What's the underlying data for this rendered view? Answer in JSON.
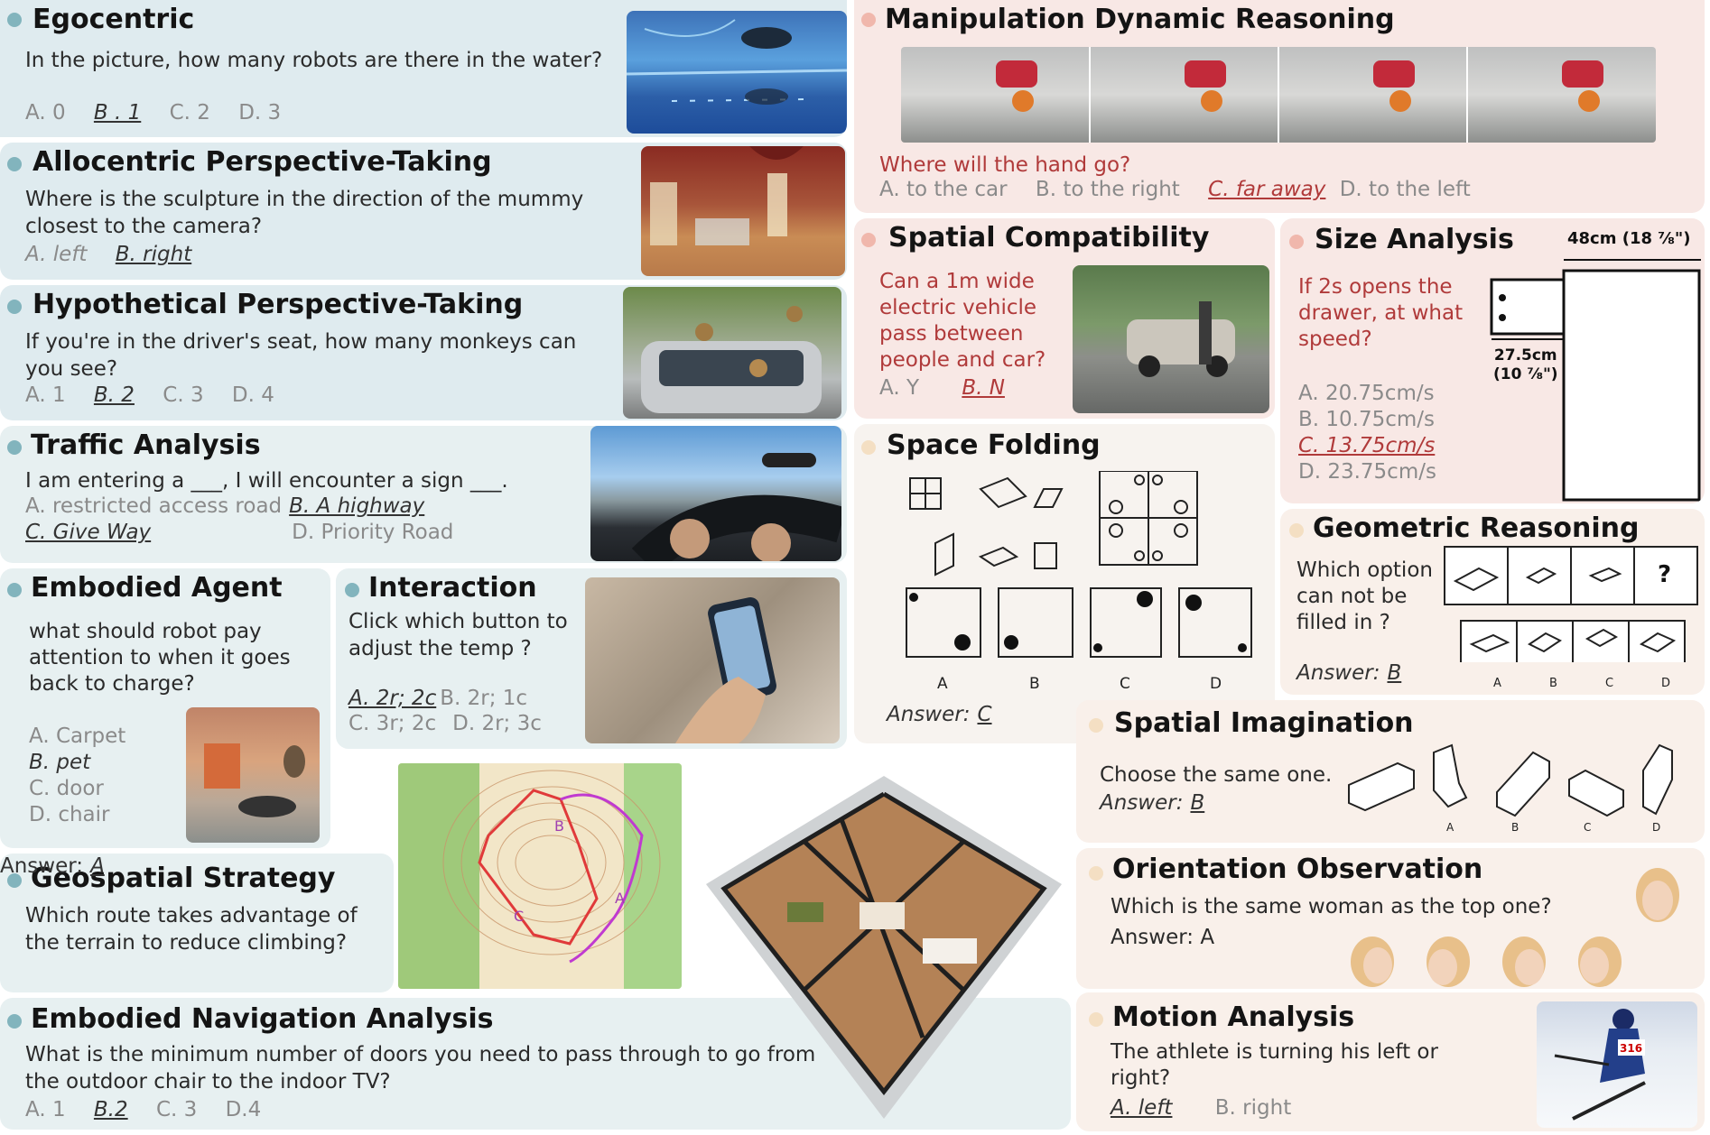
{
  "egocentric": {
    "title": "Egocentric",
    "question": "In the picture, how many robots are there in the water?",
    "options": [
      "A. 0",
      "B . 1",
      "C. 2",
      "D. 3"
    ]
  },
  "allocentric": {
    "title": "Allocentric Perspective-Taking",
    "question": "Where is the sculpture in the direction of the mummy closest to the camera?",
    "options": [
      "A. left",
      "B. right"
    ]
  },
  "hypothetical": {
    "title": "Hypothetical Perspective-Taking",
    "question": "If you're in the driver's seat, how many monkeys can you see?",
    "options": [
      "A. 1",
      "B. 2",
      "C. 3",
      "D. 4"
    ]
  },
  "traffic": {
    "title": "Traffic Analysis",
    "question": "I am entering a ___, I will encounter a sign ___.",
    "opt_a": "A. restricted access road",
    "opt_b": "B. A highway",
    "opt_c": "C. Give Way",
    "opt_d": "D. Priority Road"
  },
  "embodied_agent": {
    "title": "Embodied Agent",
    "question": "what should robot pay attention to when it goes back to charge?",
    "options": [
      "A.  Carpet",
      "B.  pet",
      "C.  door",
      "D.  chair"
    ]
  },
  "interaction": {
    "title": "Interaction",
    "question": "Click which button to adjust the temp ?",
    "opt_a": "A. 2r; 2c",
    "opt_b": "B. 2r; 1c",
    "opt_c": "C. 3r; 2c",
    "opt_d": "D. 2r; 3c"
  },
  "geospatial": {
    "title": "Geospatial Strategy",
    "question": "Which route takes advantage of the terrain to reduce climbing?",
    "answer_label": "Answer:",
    "answer": "A",
    "map_labels": [
      "B",
      "C",
      "A"
    ]
  },
  "navigation": {
    "title": "Embodied Navigation Analysis",
    "question": "What is the minimum number of doors you need to pass through to go from the outdoor chair to the indoor TV?",
    "options": [
      "A. 1",
      "B.2",
      "C. 3",
      "D.4"
    ]
  },
  "manipulation": {
    "title": "Manipulation Dynamic Reasoning",
    "question": "Where will the hand go?",
    "options": [
      "A. to the car",
      "B. to the right",
      "C. far away",
      "D. to the left"
    ]
  },
  "compatibility": {
    "title": "Spatial Compatibility",
    "question": "Can a 1m wide electric vehicle pass between people and car?",
    "options": [
      "A. Y",
      "B. N"
    ]
  },
  "size": {
    "title": "Size Analysis",
    "question": "If 2s opens the drawer, at what speed?",
    "options": [
      "A. 20.75cm/s",
      "B. 10.75cm/s",
      "C. 13.75cm/s",
      "D. 23.75cm/s"
    ],
    "dim_top": "48cm (18 ⅞\")",
    "dim_mid": "27.5cm",
    "dim_mid2": "(10 ⅞\")"
  },
  "folding": {
    "title": "Space Folding",
    "answer_label": "Answer:",
    "answer": "C",
    "choices": [
      "A",
      "B",
      "C",
      "D"
    ]
  },
  "geometric": {
    "title": "Geometric Reasoning",
    "question": "Which option can not be filled in ?",
    "answer_label": "Answer:",
    "answer": "B",
    "mark": "?",
    "choices": [
      "A",
      "B",
      "C",
      "D"
    ]
  },
  "imagination": {
    "title": "Spatial Imagination",
    "question": "Choose the same one.",
    "answer_label": "Answer:",
    "answer": "B",
    "choices": [
      "A",
      "B",
      "C",
      "D"
    ]
  },
  "orientation": {
    "title": "Orientation Observation",
    "question": "Which is the same woman as the top one?",
    "answer": "Answer: A"
  },
  "motion": {
    "title": "Motion Analysis",
    "question": "The athlete is turning his left or right?",
    "options": [
      "A. left",
      "B. right"
    ],
    "bib": "316"
  }
}
